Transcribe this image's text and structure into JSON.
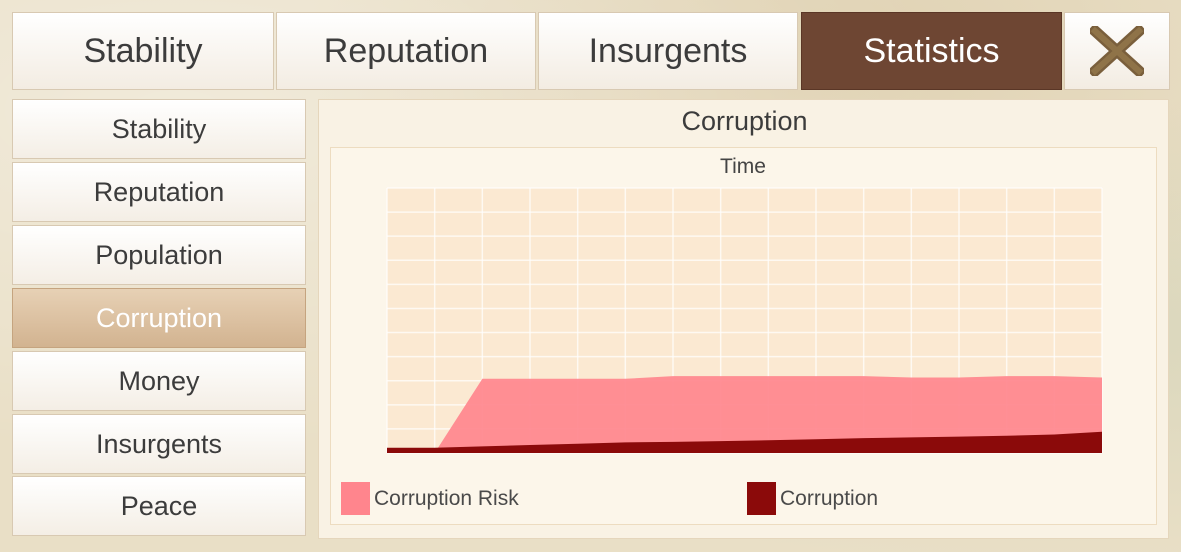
{
  "tabs": [
    {
      "label": "Stability",
      "active": false
    },
    {
      "label": "Reputation",
      "active": false
    },
    {
      "label": "Insurgents",
      "active": false
    },
    {
      "label": "Statistics",
      "active": true
    }
  ],
  "close_icon": "close-x-icon",
  "sidebar": {
    "items": [
      {
        "label": "Stability"
      },
      {
        "label": "Reputation"
      },
      {
        "label": "Population"
      },
      {
        "label": "Corruption",
        "active": true
      },
      {
        "label": "Money"
      },
      {
        "label": "Insurgents"
      },
      {
        "label": "Peace"
      }
    ]
  },
  "panel": {
    "title": "Corruption"
  },
  "colors": {
    "active_tab": "#6e4633",
    "corruption_risk": "#ff858d",
    "corruption": "#8b0a0a"
  },
  "chart_data": {
    "type": "area",
    "title": "Corruption",
    "xlabel": "Time",
    "ylabel": "",
    "ylim": [
      0,
      100
    ],
    "grid": true,
    "legend_position": "bottom",
    "x": [
      0,
      1,
      2,
      3,
      4,
      5,
      6,
      7,
      8,
      9,
      10,
      11,
      12,
      13,
      14,
      15
    ],
    "series": [
      {
        "name": "Corruption Risk",
        "color": "#ff858d",
        "values": [
          0,
          0,
          28,
          28,
          28,
          28,
          29,
          29,
          29,
          29,
          29,
          28.5,
          28.5,
          29,
          29,
          28.5
        ]
      },
      {
        "name": "Corruption",
        "color": "#8b0a0a",
        "values": [
          2,
          2,
          2.5,
          3,
          3.5,
          4,
          4.2,
          4.5,
          4.8,
          5.2,
          5.6,
          5.9,
          6.2,
          6.5,
          7,
          8
        ]
      }
    ]
  }
}
